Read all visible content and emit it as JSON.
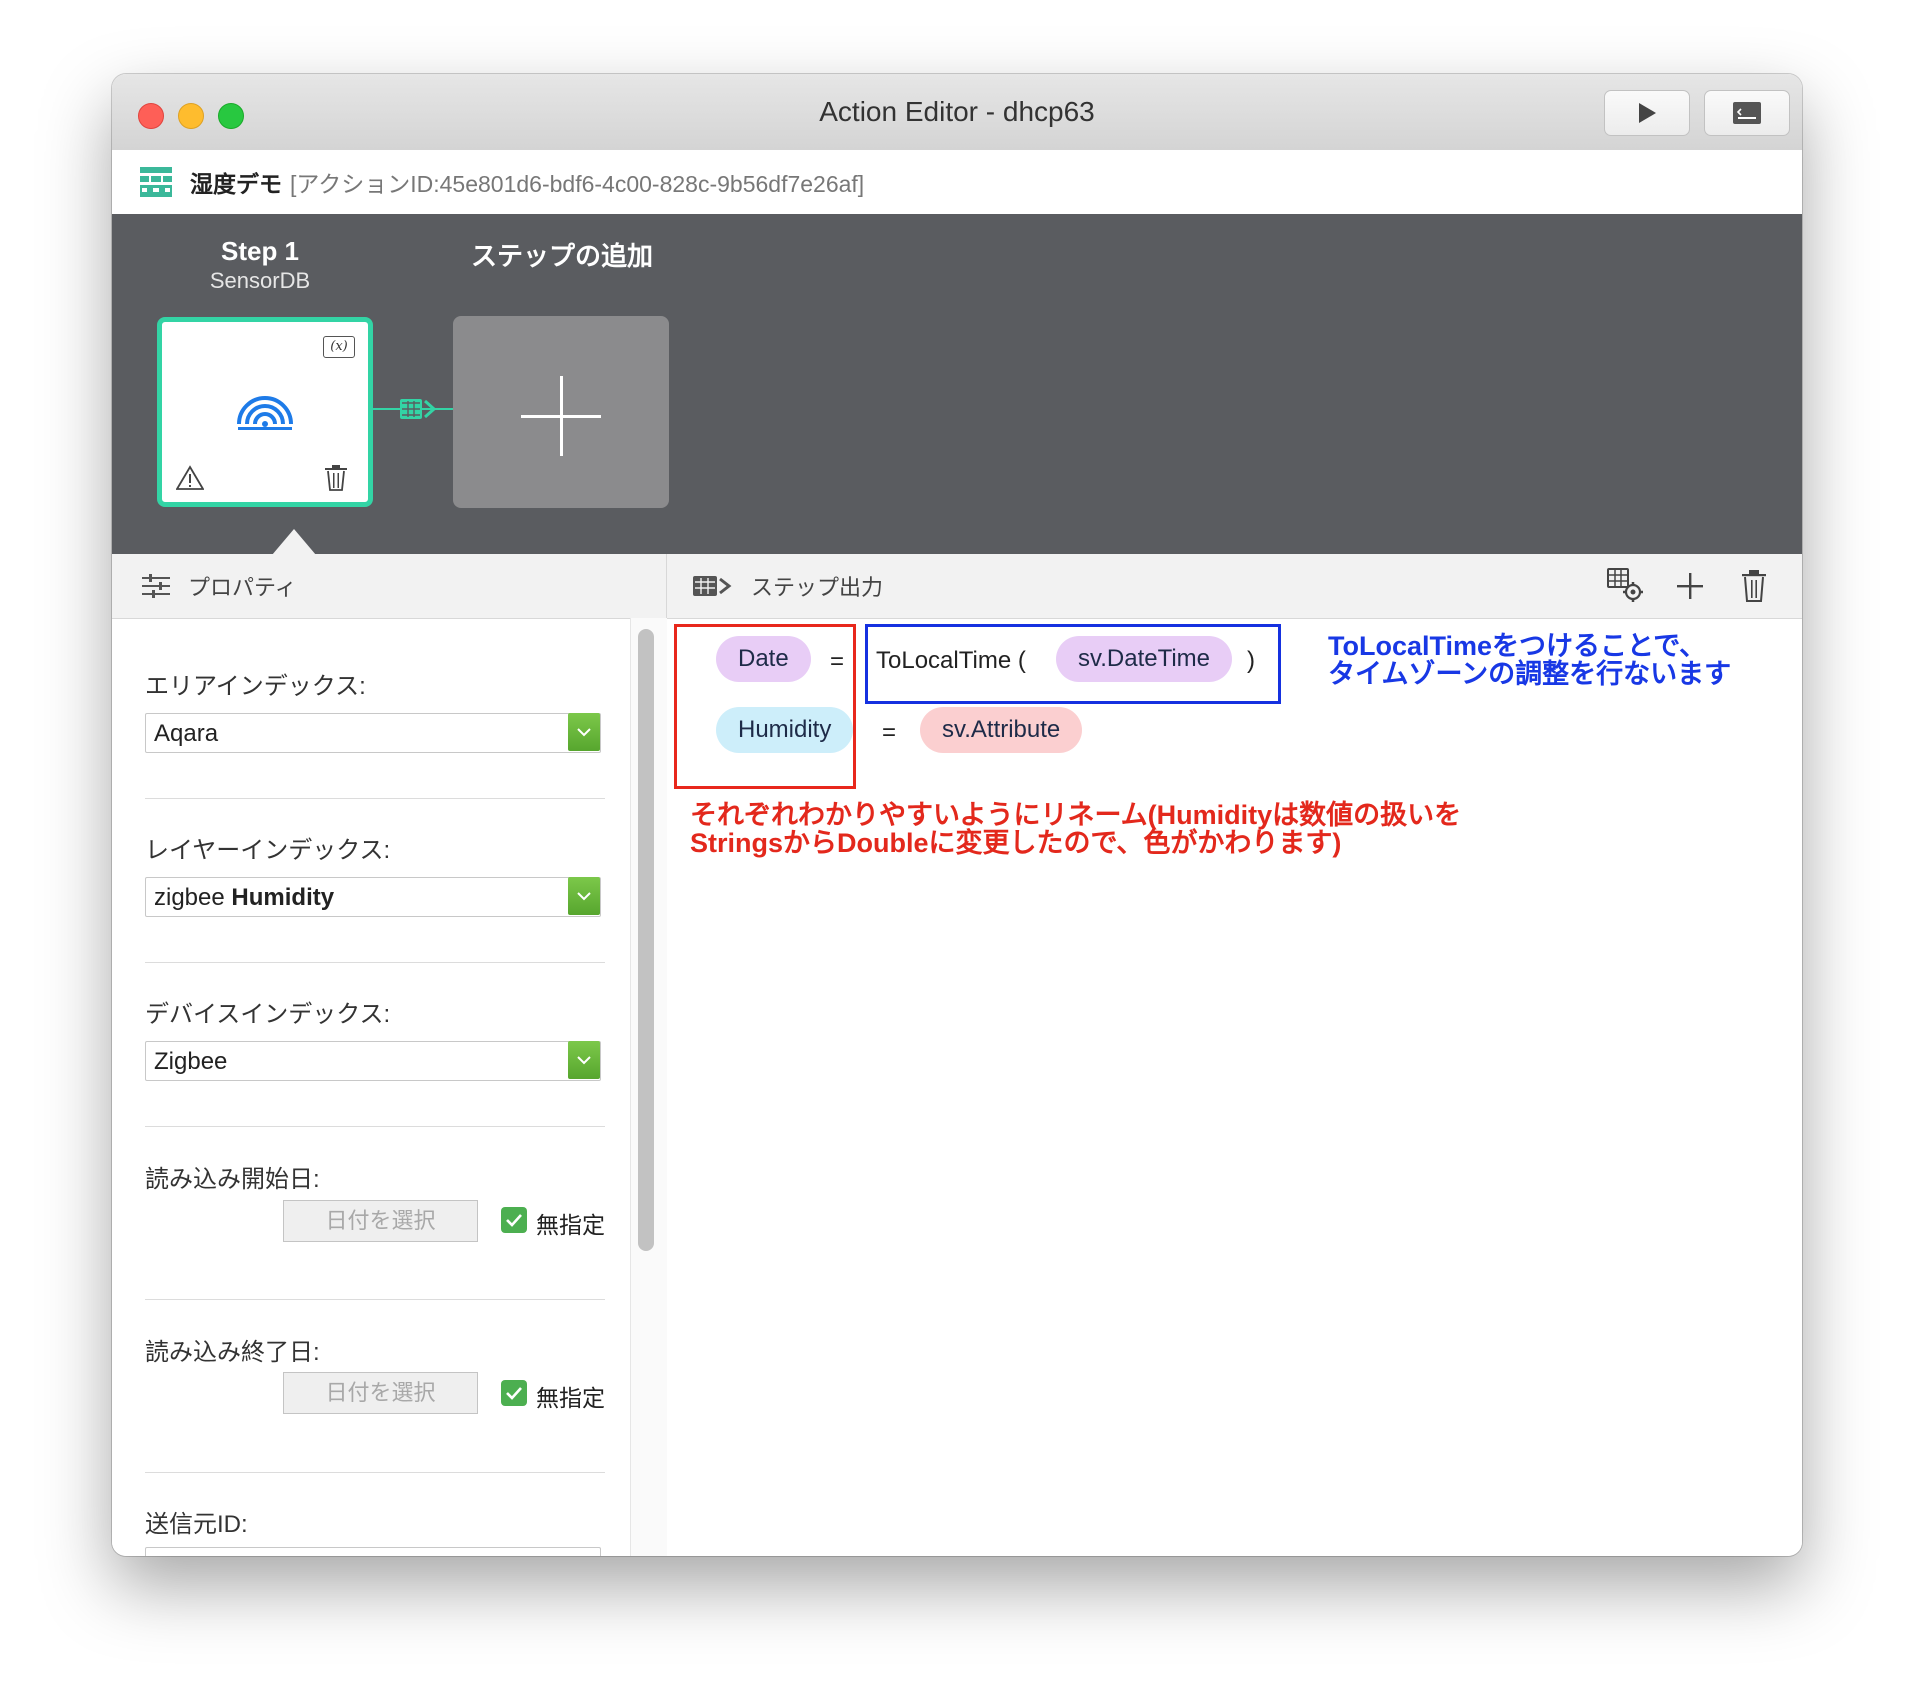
{
  "window": {
    "title": "Action Editor - dhcp63"
  },
  "header": {
    "action_name": "湿度デモ",
    "action_id": "[アクションID:45e801d6-bdf6-4c00-828c-9b56df7e26af]"
  },
  "steps": [
    {
      "title": "Step 1",
      "subtitle": "SensorDB",
      "badge": "(x)"
    },
    {
      "title": "ステップの追加"
    }
  ],
  "properties": {
    "title": "プロパティ",
    "area_index": {
      "label": "エリアインデックス:",
      "value": "Aqara"
    },
    "layer_index": {
      "label": "レイヤーインデックス:",
      "value_prefix": "zigbee",
      "value_bold": "Humidity"
    },
    "device_index": {
      "label": "デバイスインデックス:",
      "value": "Zigbee"
    },
    "read_start": {
      "label": "読み込み開始日:",
      "button": "日付を選択",
      "checkbox_label": "無指定",
      "checked": true
    },
    "read_end": {
      "label": "読み込み終了日:",
      "button": "日付を選択",
      "checkbox_label": "無指定",
      "checked": true
    },
    "sender_id": {
      "label": "送信元ID:"
    }
  },
  "step_output": {
    "title": "ステップ出力",
    "rows": [
      {
        "left": "Date",
        "eq": "=",
        "func": "ToLocalTime (",
        "arg": "sv.DateTime",
        "close": ")"
      },
      {
        "left": "Humidity",
        "eq": "=",
        "value": "sv.Attribute"
      }
    ]
  },
  "annotations": {
    "blue": [
      "ToLocalTimeをつけることで、",
      "タイムゾーンの調整を行ないます"
    ],
    "red": [
      "それぞれわかりやすいようにリネーム(Humidityは数値の扱いを",
      "StringsからDoubleに変更したので、色がかわります)"
    ]
  },
  "colors": {
    "accent_green": "#33d4a5",
    "annotation_red": "#e8281c",
    "annotation_blue": "#1531e0",
    "step_bar": "#5a5c60"
  },
  "icons": [
    "run-icon",
    "terminal-icon",
    "table-icon",
    "sensor-wifi-icon",
    "warning-icon",
    "trash-icon",
    "plus-icon",
    "sliders-icon",
    "output-icon",
    "gear-table-icon",
    "chevron-down-icon",
    "check-icon"
  ]
}
